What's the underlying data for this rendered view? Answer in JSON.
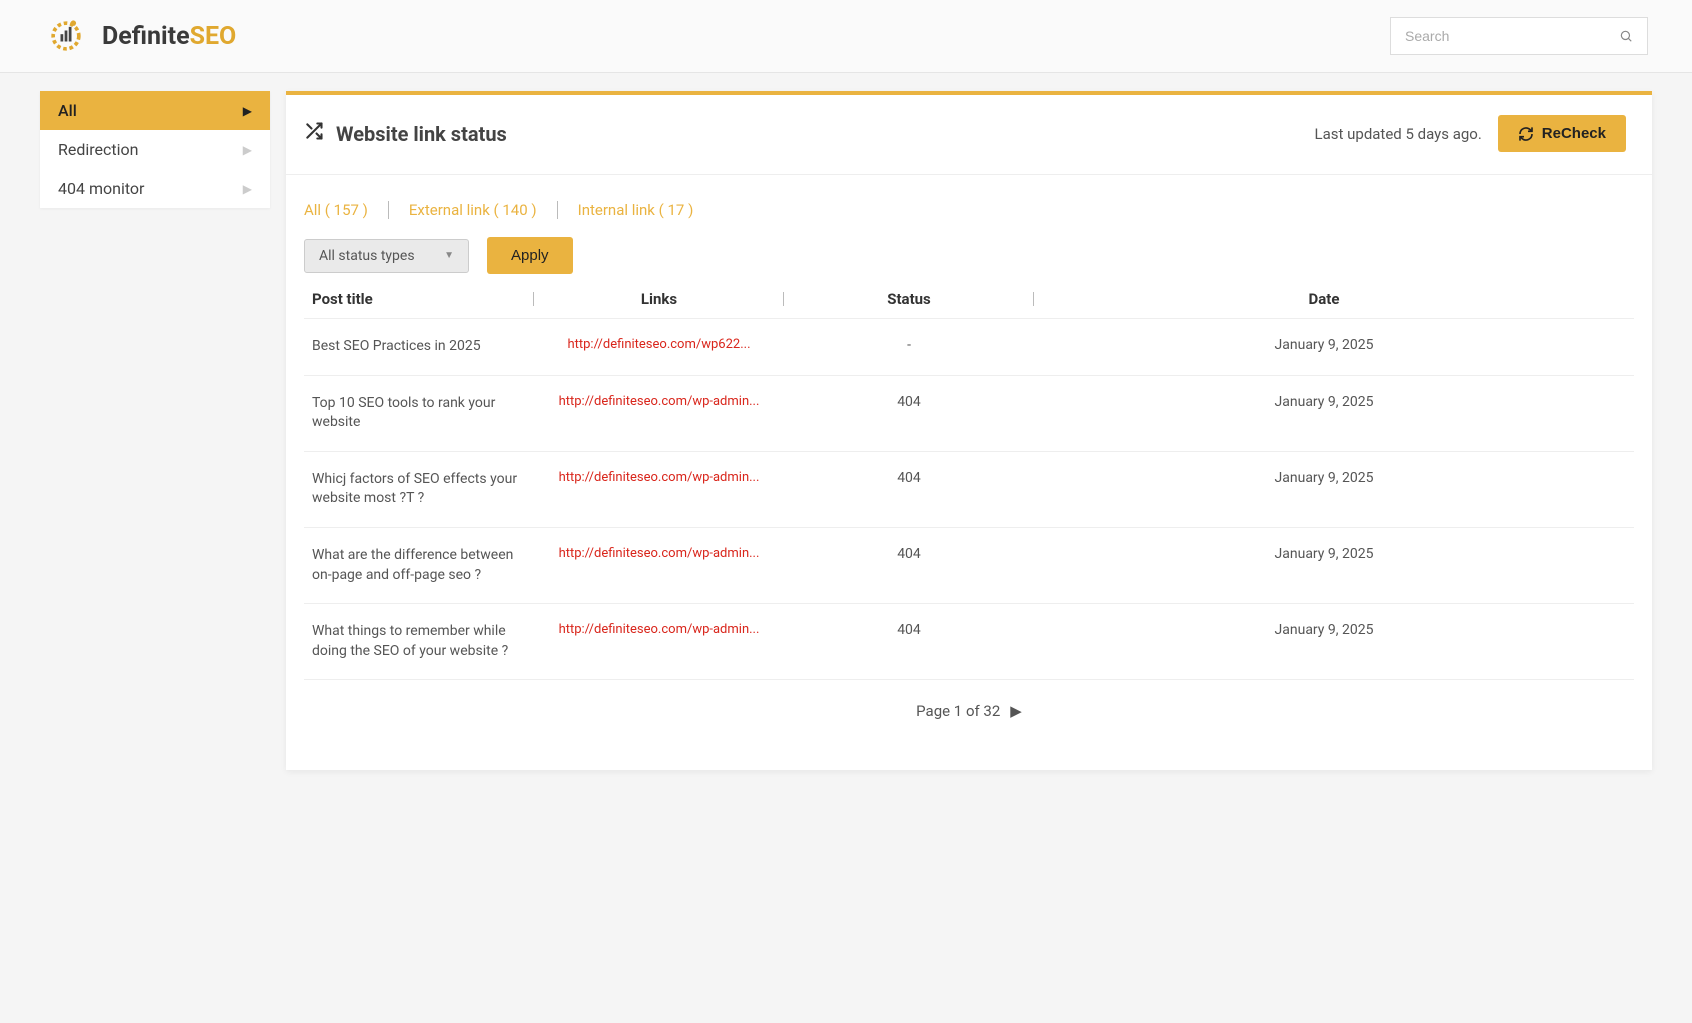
{
  "brand": {
    "part1": "Definite",
    "part2": "SEO"
  },
  "search": {
    "placeholder": "Search"
  },
  "sidebar": {
    "items": [
      {
        "label": "All",
        "active": true
      },
      {
        "label": "Redirection",
        "active": false
      },
      {
        "label": "404 monitor",
        "active": false
      }
    ]
  },
  "page": {
    "title": "Website link status",
    "last_updated": "Last updated 5 days ago.",
    "recheck_label": "ReCheck"
  },
  "tabs": [
    {
      "label": "All ( 157 )"
    },
    {
      "label": "External link ( 140 )"
    },
    {
      "label": "Internal link ( 17 )"
    }
  ],
  "filter": {
    "status_types": "All status types",
    "apply": "Apply"
  },
  "columns": {
    "title": "Post title",
    "link": "Links",
    "status": "Status",
    "date": "Date"
  },
  "rows": [
    {
      "title": "Best SEO Practices in 2025",
      "link": "http://definiteseo.com/wp622...",
      "status": "-",
      "date": "January 9, 2025"
    },
    {
      "title": "Top 10 SEO tools to rank your website",
      "link": "http://definiteseo.com/wp-admin...",
      "status": "404",
      "date": "January 9, 2025"
    },
    {
      "title": "Whicj factors of SEO effects your website most ?T ?",
      "link": "http://definiteseo.com/wp-admin...",
      "status": "404",
      "date": "January 9, 2025"
    },
    {
      "title": "What are the difference between on-page and off-page seo ?",
      "link": "http://definiteseo.com/wp-admin...",
      "status": "404",
      "date": "January 9, 2025"
    },
    {
      "title": "What things to remember while doing the SEO of your website ?",
      "link": "http://definiteseo.com/wp-admin...",
      "status": "404",
      "date": "January 9, 2025"
    }
  ],
  "pagination": {
    "text": "Page 1 of 32"
  }
}
